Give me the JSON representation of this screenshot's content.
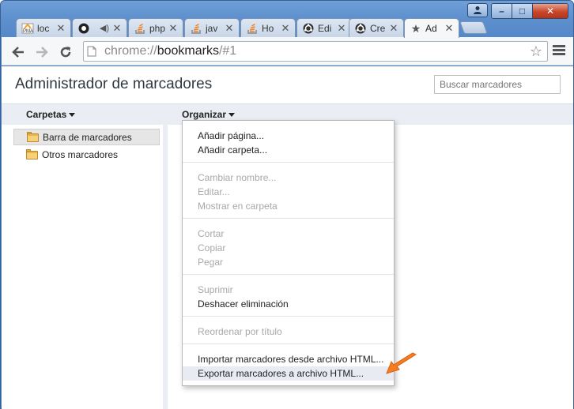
{
  "window": {
    "controls": {
      "minimize": "–",
      "maximize": "□",
      "close": "✕"
    }
  },
  "tabs": [
    {
      "title": "loc",
      "icon": "pma-icon"
    },
    {
      "title": "",
      "icon": "speaker-icon"
    },
    {
      "title": "php",
      "icon": "stack-icon"
    },
    {
      "title": "jav",
      "icon": "stack-icon"
    },
    {
      "title": "Ho",
      "icon": "stack-icon"
    },
    {
      "title": "Edi",
      "icon": "ubuntu-icon"
    },
    {
      "title": "Cre",
      "icon": "ubuntu-icon"
    },
    {
      "title": "Ad",
      "icon": "star-icon",
      "active": true
    }
  ],
  "toolbar": {
    "url_scheme": "chrome://",
    "url_host": "bookmarks",
    "url_path": "/#1"
  },
  "page": {
    "title": "Administrador de marcadores",
    "search_placeholder": "Buscar marcadores",
    "folders_label": "Carpetas",
    "organize_label": "Organizar"
  },
  "tree": [
    {
      "label": "Barra de marcadores",
      "selected": true
    },
    {
      "label": "Otros marcadores",
      "selected": false
    }
  ],
  "menu": {
    "groups": [
      [
        {
          "label": "Añadir página...",
          "enabled": true
        },
        {
          "label": "Añadir carpeta...",
          "enabled": true
        }
      ],
      [
        {
          "label": "Cambiar nombre...",
          "enabled": false
        },
        {
          "label": "Editar...",
          "enabled": false
        },
        {
          "label": "Mostrar en carpeta",
          "enabled": false
        }
      ],
      [
        {
          "label": "Cortar",
          "enabled": false
        },
        {
          "label": "Copiar",
          "enabled": false
        },
        {
          "label": "Pegar",
          "enabled": false
        }
      ],
      [
        {
          "label": "Suprimir",
          "enabled": false
        },
        {
          "label": "Deshacer eliminación",
          "enabled": true
        }
      ],
      [
        {
          "label": "Reordenar por título",
          "enabled": false
        }
      ],
      [
        {
          "label": "Importar marcadores desde archivo HTML...",
          "enabled": true
        },
        {
          "label": "Exportar marcadores a archivo HTML...",
          "enabled": true,
          "hover": true
        }
      ]
    ]
  },
  "colors": {
    "annotation_arrow": "#f57c1f",
    "frame": "#5d8fcd"
  }
}
